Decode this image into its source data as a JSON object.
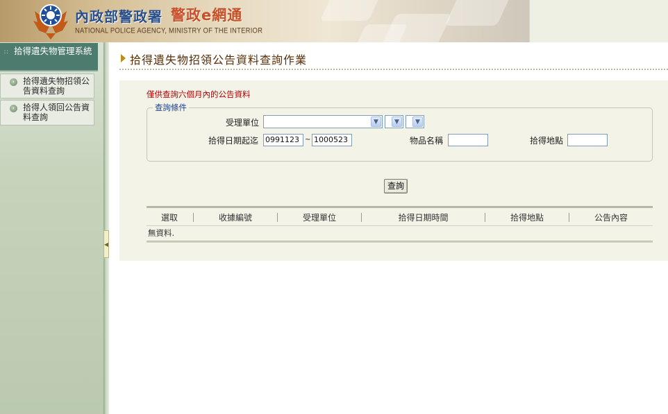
{
  "header": {
    "agency_zh": "內政部警政署",
    "portal_name": "警政e網通",
    "agency_en": "NATIONAL POLICE AGENCY, MINISTRY OF THE INTERIOR"
  },
  "sidebar": {
    "system_title": "拾得遺失物管理系統",
    "items": [
      {
        "label": "拾得遺失物招領公告資料查詢"
      },
      {
        "label": "拾得人領回公告資料查詢"
      }
    ],
    "collapse_icon": "triangle-left"
  },
  "main": {
    "page_title": "拾得遺失物招領公告資料查詢作業",
    "notice": "僅供查詢六個月內的公告資料",
    "criteria_legend": "查詢條件",
    "fields": {
      "unit_label": "受理單位",
      "unit_value": "",
      "date_label": "拾得日期起迄",
      "date_from": "0991123",
      "date_sep": "~",
      "date_to": "1000523",
      "item_label": "物品名稱",
      "item_value": "",
      "place_label": "拾得地點",
      "place_value": ""
    },
    "query_button": "查詢",
    "results": {
      "columns": [
        "選取",
        "收據編號",
        "受理單位",
        "拾得日期時間",
        "拾得地點",
        "公告內容"
      ],
      "empty_text": "無資料."
    }
  },
  "colors": {
    "sidebar_title_bg": "#4d7c6e",
    "notice_red": "#b30000",
    "title_brown": "#5a2e06",
    "legend_blue": "#1d3f8c"
  }
}
